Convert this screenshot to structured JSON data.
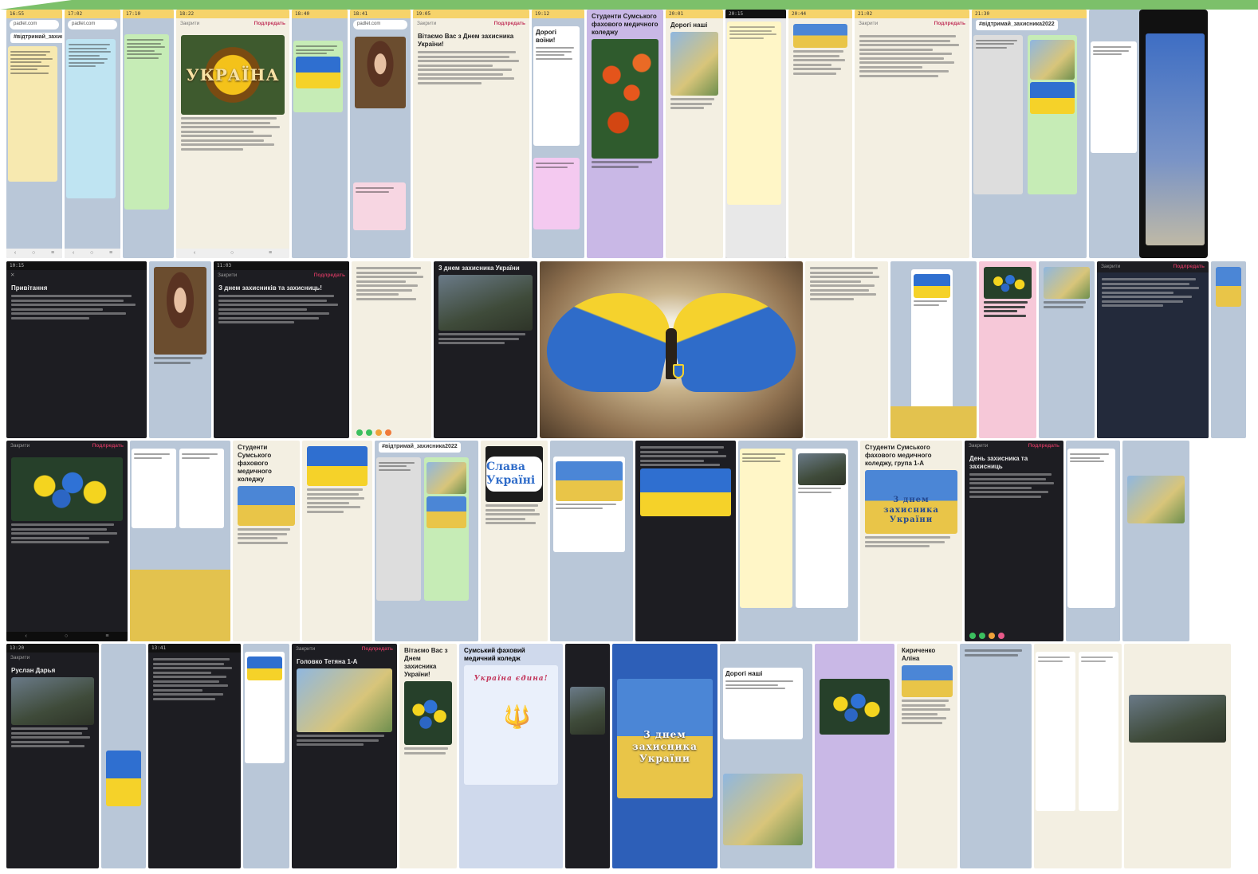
{
  "ui": {
    "close_label": "Закрити",
    "submit_label": "Подлредать",
    "hashtag": "#відтримай_захисника2022",
    "address": "padlet.com"
  },
  "texts": {
    "ukraine": "УКРАЇНА",
    "students": "Студенти Сумського фахового медичного коледжу",
    "greeting": "Привітання",
    "congrats_title": "З днем захисників та захисниць!",
    "day_defenders_2": "3 днем захисника України",
    "slava": "Слава Україні",
    "medical_college": "Сумський фаховий медичний коледж",
    "ukraine_one": "Україна єдина!",
    "dear_soldiers": "Дорогі воїни!",
    "dear_all": "Дорогі наші",
    "from_group": "Студенти Сумського фахового медичного коледжу, група 1-А",
    "congrats_group": "Вітаємо Вас з Днем захисника України!",
    "happy_day": "День захисника та захисниць",
    "name_1": "Головко Тетяна 1-А",
    "name_2": "Руслан Дарья",
    "name_3": "Кириченко Аліна"
  }
}
